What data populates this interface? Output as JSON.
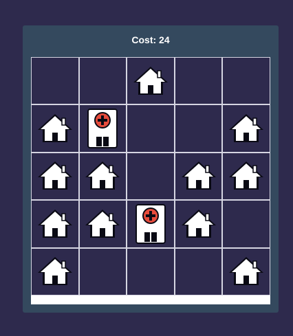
{
  "header": {
    "cost_label": "Cost: 24"
  },
  "grid": {
    "rows": [
      [
        "empty",
        "empty",
        "house",
        "empty",
        "empty"
      ],
      [
        "house",
        "hospital",
        "empty",
        "empty",
        "house"
      ],
      [
        "house",
        "house",
        "empty",
        "house",
        "house"
      ],
      [
        "house",
        "house",
        "hospital",
        "house",
        "empty"
      ],
      [
        "house",
        "empty",
        "empty",
        "empty",
        "house"
      ]
    ]
  },
  "icons": {
    "house": "house-icon",
    "hospital": "hospital-icon"
  },
  "colors": {
    "background": "#2e2a4d",
    "panel": "#34495e",
    "cell": "#2e2a4d",
    "grid_line": "#d6d6e2",
    "hospital_cross": "#e74c3c"
  }
}
